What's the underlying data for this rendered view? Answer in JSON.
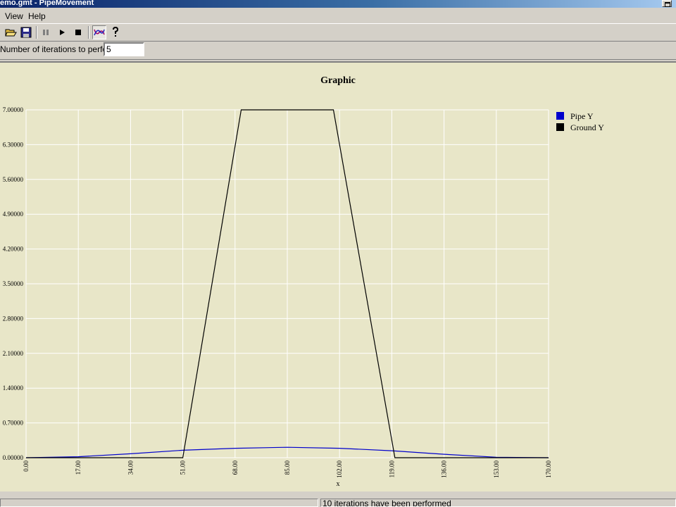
{
  "window": {
    "title": "emo.gmt - PipeMovement"
  },
  "menu": {
    "items": [
      "View",
      "Help"
    ]
  },
  "toolbar": {
    "buttons": [
      "open-icon",
      "save-icon",
      "pause-icon",
      "play-icon",
      "stop-icon",
      "graph-icon",
      "help-icon"
    ]
  },
  "iterations": {
    "label": "Number of iterations to perform",
    "value": "5"
  },
  "status": {
    "message": "10 iterations have been performed"
  },
  "colors": {
    "background": "#e8e6c8",
    "pipe": "#0000cc",
    "ground": "#000000",
    "grid": "#ffffff"
  },
  "chart_data": {
    "type": "line",
    "title": "Graphic",
    "xlabel": "x",
    "ylabel": "",
    "xlim": [
      0,
      170
    ],
    "ylim": [
      0,
      7
    ],
    "x_ticks": [
      "0.00",
      "17.00",
      "34.00",
      "51.00",
      "68.00",
      "85.00",
      "102.00",
      "119.00",
      "136.00",
      "153.00",
      "170.00"
    ],
    "y_ticks": [
      "0.00000",
      "0.70000",
      "1.40000",
      "2.10000",
      "2.80000",
      "3.50000",
      "4.20000",
      "4.90000",
      "5.60000",
      "6.30000",
      "7.00000"
    ],
    "grid": true,
    "legend_position": "top-right",
    "series": [
      {
        "name": "Pipe Y",
        "color": "#0000cc",
        "x": [
          0,
          17,
          34,
          51,
          68,
          85,
          102,
          119,
          136,
          153,
          170
        ],
        "y": [
          0.0,
          0.02,
          0.08,
          0.15,
          0.19,
          0.21,
          0.19,
          0.14,
          0.07,
          0.01,
          0.0
        ]
      },
      {
        "name": "Ground Y",
        "color": "#000000",
        "x": [
          0,
          51,
          70,
          100,
          120,
          170
        ],
        "y": [
          0,
          0,
          7,
          7,
          0,
          0
        ]
      }
    ]
  }
}
